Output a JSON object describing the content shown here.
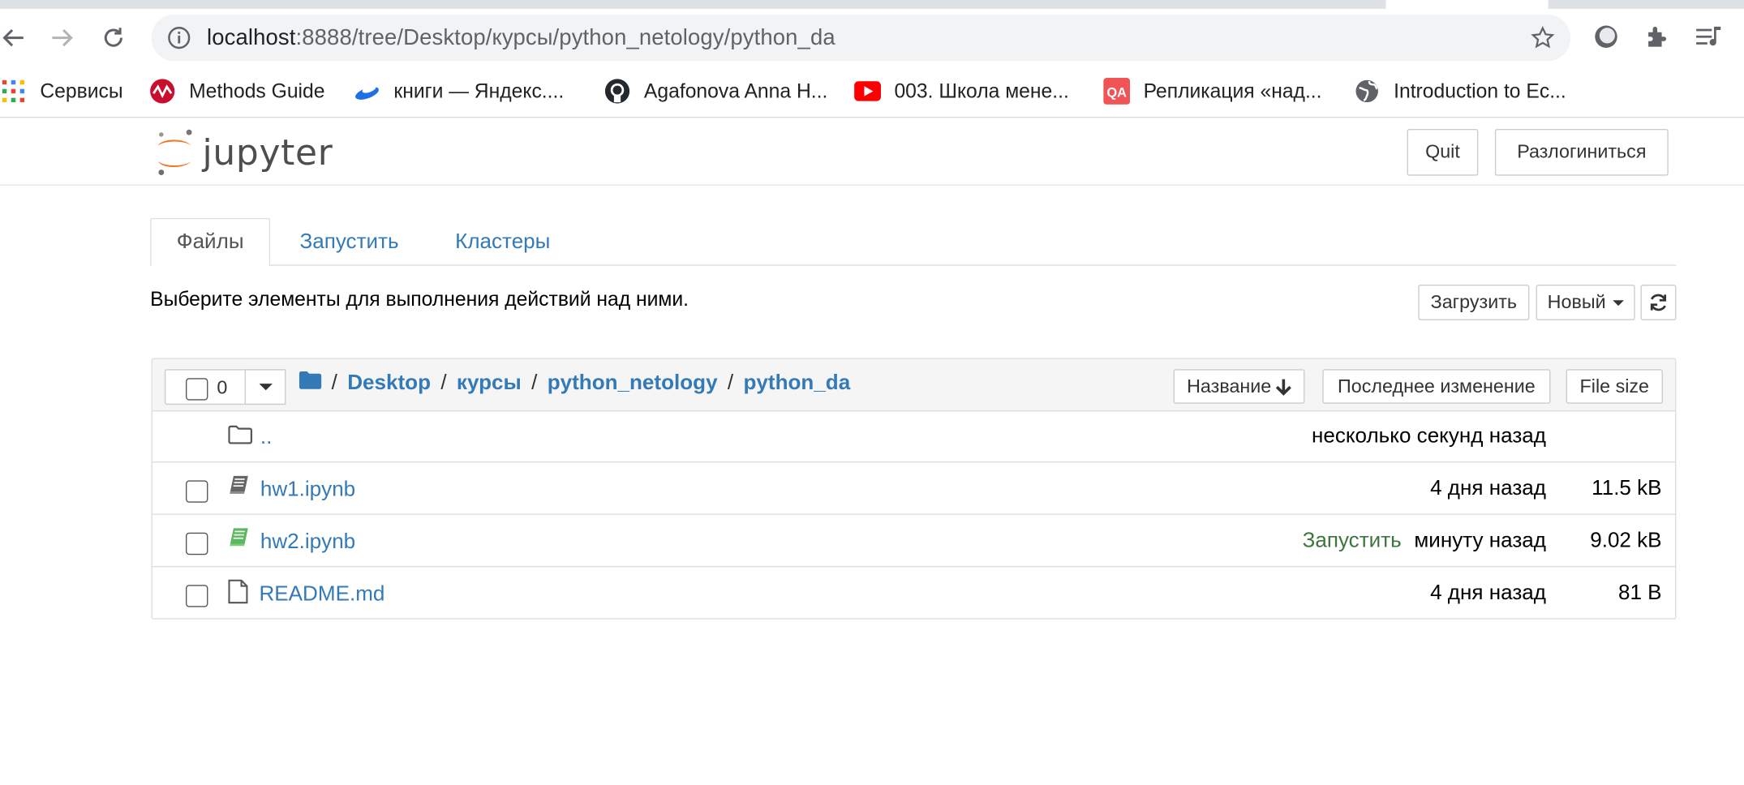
{
  "browser": {
    "url_host": "localhost",
    "url_rest": ":8888/tree/Desktop/курсы/python_netology/python_da"
  },
  "bookmarks": [
    {
      "label": "Сервисы",
      "icon": "apps-grid-icon"
    },
    {
      "label": "Methods Guide",
      "icon": "methods-guide-icon"
    },
    {
      "label": "книги — Яндекс....",
      "icon": "yandex-disk-icon"
    },
    {
      "label": "Agafonova Anna H...",
      "icon": "github-icon"
    },
    {
      "label": "003. Школа мене...",
      "icon": "youtube-icon"
    },
    {
      "label": "Репликация «над...",
      "icon": "qa-icon"
    },
    {
      "label": "Introduction to Ec...",
      "icon": "globe-icon"
    }
  ],
  "header": {
    "logo_text": "jupyter",
    "quit_label": "Quit",
    "logout_label": "Разлогиниться"
  },
  "tabs": [
    {
      "label": "Файлы",
      "active": true
    },
    {
      "label": "Запустить",
      "active": false
    },
    {
      "label": "Кластеры",
      "active": false
    }
  ],
  "toolbar": {
    "hint": "Выберите элементы для выполнения действий над ними.",
    "upload_label": "Загрузить",
    "new_label": "Новый"
  },
  "filelist": {
    "selected_count": "0",
    "breadcrumbs": [
      "Desktop",
      "курсы",
      "python_netology",
      "python_da"
    ],
    "sort_name_label": "Название",
    "sort_modified_label": "Последнее изменение",
    "sort_size_label": "File size",
    "rows": [
      {
        "name": "..",
        "type": "parent-folder",
        "status": "",
        "modified": "несколько секунд назад",
        "size": ""
      },
      {
        "name": "hw1.ipynb",
        "type": "notebook",
        "status": "",
        "modified": "4 дня назад",
        "size": "11.5 kB"
      },
      {
        "name": "hw2.ipynb",
        "type": "notebook-running",
        "status": "Запустить",
        "modified": "минуту назад",
        "size": "9.02 kB"
      },
      {
        "name": "README.md",
        "type": "file",
        "status": "",
        "modified": "4 дня назад",
        "size": "81 B"
      }
    ]
  },
  "colors": {
    "link": "#337ab7",
    "running": "#3c763d",
    "notebook_running_icon": "#5cb85c",
    "jupyter_orange": "#f37726"
  }
}
